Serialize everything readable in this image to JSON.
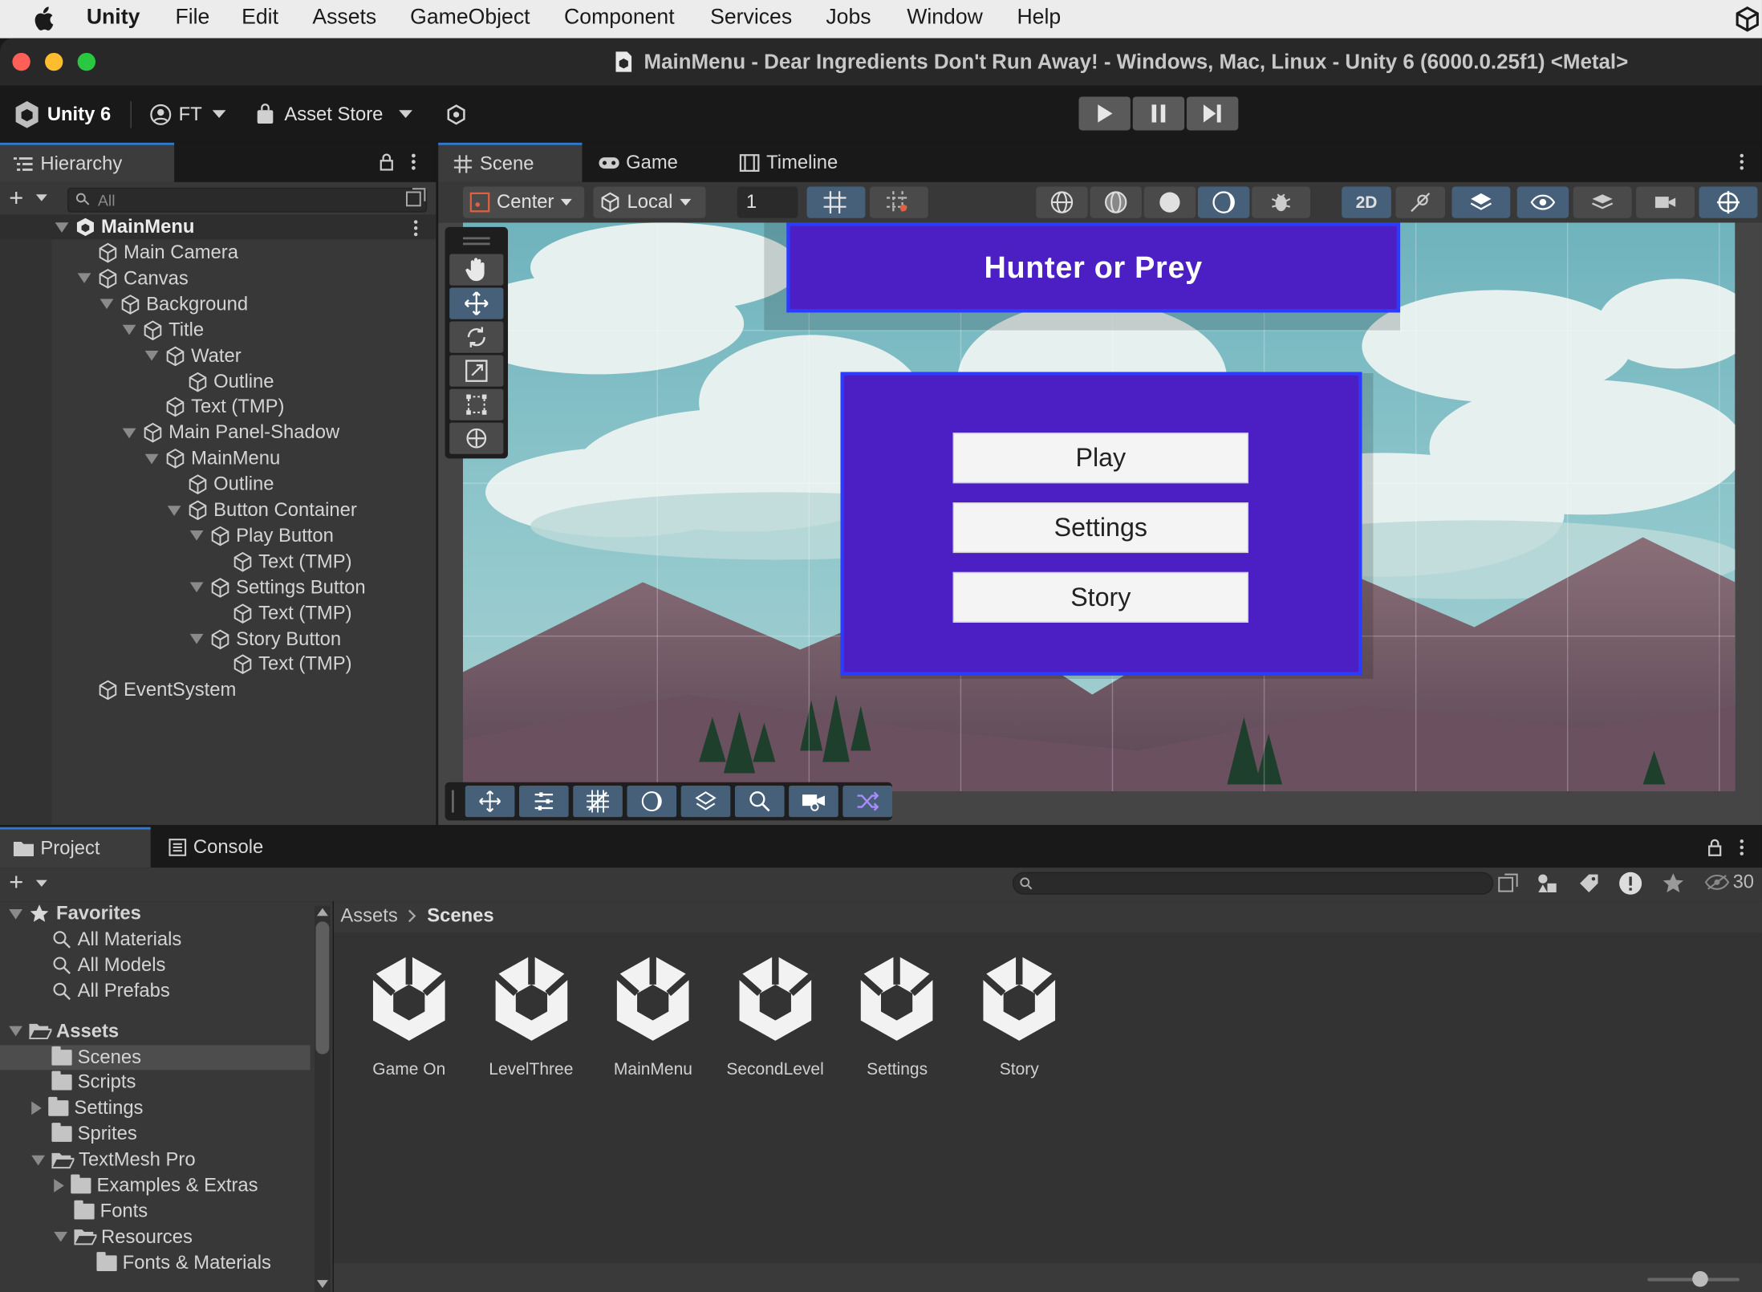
{
  "menubar": {
    "app": "Unity",
    "items": [
      "File",
      "Edit",
      "Assets",
      "GameObject",
      "Component",
      "Services",
      "Jobs",
      "Window",
      "Help"
    ]
  },
  "window": {
    "title": "MainMenu - Dear Ingredients Don't Run Away! - Windows, Mac, Linux - Unity 6 (6000.0.25f1) <Metal>"
  },
  "toolbar": {
    "unity_label": "Unity 6",
    "account_label": "FT",
    "asset_store_label": "Asset Store"
  },
  "hierarchy": {
    "tab_label": "Hierarchy",
    "search_placeholder": "All",
    "scene_name": "MainMenu",
    "items": [
      {
        "label": "Main Camera",
        "depth": 1,
        "expand": "none"
      },
      {
        "label": "Canvas",
        "depth": 1,
        "expand": "open"
      },
      {
        "label": "Background",
        "depth": 2,
        "expand": "open"
      },
      {
        "label": "Title",
        "depth": 3,
        "expand": "open"
      },
      {
        "label": "Water",
        "depth": 4,
        "expand": "open"
      },
      {
        "label": "Outline",
        "depth": 5,
        "expand": "none"
      },
      {
        "label": "Text (TMP)",
        "depth": 4,
        "expand": "none"
      },
      {
        "label": "Main Panel-Shadow",
        "depth": 3,
        "expand": "open"
      },
      {
        "label": "MainMenu",
        "depth": 4,
        "expand": "open"
      },
      {
        "label": "Outline",
        "depth": 5,
        "expand": "none"
      },
      {
        "label": "Button Container",
        "depth": 5,
        "expand": "open"
      },
      {
        "label": "Play Button",
        "depth": 6,
        "expand": "open"
      },
      {
        "label": "Text (TMP)",
        "depth": 7,
        "expand": "none"
      },
      {
        "label": "Settings Button",
        "depth": 6,
        "expand": "open"
      },
      {
        "label": "Text (TMP)",
        "depth": 7,
        "expand": "none"
      },
      {
        "label": "Story Button",
        "depth": 6,
        "expand": "open"
      },
      {
        "label": "Text (TMP)",
        "depth": 7,
        "expand": "none"
      },
      {
        "label": "EventSystem",
        "depth": 1,
        "expand": "none"
      }
    ]
  },
  "scene_tabs": {
    "scene": "Scene",
    "game": "Game",
    "timeline": "Timeline"
  },
  "scene_toolbar": {
    "pivot": "Center",
    "space": "Local",
    "grid_value": "1",
    "mode_2d": "2D"
  },
  "scene_view": {
    "title_text": "Hunter or Prey",
    "buttons": [
      "Play",
      "Settings",
      "Story"
    ],
    "panel_color": "#4c1fc4",
    "sky_color": "#7fbdc6"
  },
  "project": {
    "tab_project": "Project",
    "tab_console": "Console",
    "hidden_count": "30",
    "breadcrumb": {
      "root": "Assets",
      "current": "Scenes"
    },
    "tree": [
      {
        "label": "Favorites",
        "depth": 0,
        "kind": "star",
        "expand": "open",
        "bold": true
      },
      {
        "label": "All Materials",
        "depth": 1,
        "kind": "search",
        "expand": "none"
      },
      {
        "label": "All Models",
        "depth": 1,
        "kind": "search",
        "expand": "none"
      },
      {
        "label": "All Prefabs",
        "depth": 1,
        "kind": "search",
        "expand": "none"
      },
      {
        "label": "Assets",
        "depth": 0,
        "kind": "folder-open",
        "expand": "open",
        "bold": true
      },
      {
        "label": "Scenes",
        "depth": 1,
        "kind": "folder",
        "expand": "none",
        "selected": true
      },
      {
        "label": "Scripts",
        "depth": 1,
        "kind": "folder",
        "expand": "none"
      },
      {
        "label": "Settings",
        "depth": 1,
        "kind": "folder",
        "expand": "closed"
      },
      {
        "label": "Sprites",
        "depth": 1,
        "kind": "folder",
        "expand": "none"
      },
      {
        "label": "TextMesh Pro",
        "depth": 1,
        "kind": "folder-open",
        "expand": "open"
      },
      {
        "label": "Examples & Extras",
        "depth": 2,
        "kind": "folder",
        "expand": "closed"
      },
      {
        "label": "Fonts",
        "depth": 2,
        "kind": "folder",
        "expand": "none"
      },
      {
        "label": "Resources",
        "depth": 2,
        "kind": "folder-open",
        "expand": "open"
      },
      {
        "label": "Fonts & Materials",
        "depth": 3,
        "kind": "folder",
        "expand": "none"
      }
    ],
    "assets": [
      "Game On",
      "LevelThree",
      "MainMenu",
      "SecondLevel",
      "Settings",
      "Story"
    ]
  }
}
